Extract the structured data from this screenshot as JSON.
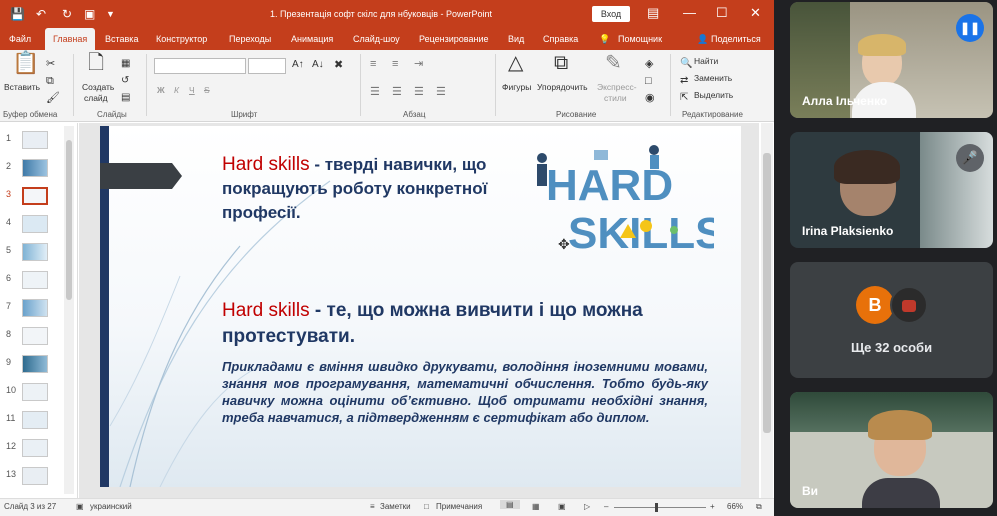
{
  "window": {
    "title": "1. Презентація софт скілс для нбуковців - PowerPoint",
    "signin": "Вход"
  },
  "tabs": [
    "Файл",
    "Главная",
    "Вставка",
    "Конструктор",
    "Переходы",
    "Анимация",
    "Слайд-шоу",
    "Рецензирование",
    "Вид",
    "Справка",
    "Помощник",
    "Поделиться"
  ],
  "ribbon": {
    "paste": "Вставить",
    "create_slide_1": "Создать",
    "create_slide_2": "слайд",
    "font_bold": "Ж",
    "font_italic": "К",
    "font_underline": "Ч",
    "font_strike": "S",
    "shapes": "Фигуры",
    "arrange": "Упорядочить",
    "quick_styles_1": "Экспресс-",
    "quick_styles_2": "стили",
    "find": "Найти",
    "replace": "Заменить",
    "select": "Выделить",
    "groups": [
      "Буфер обмена",
      "Слайды",
      "Шрифт",
      "Абзац",
      "Рисование",
      "Редактирование"
    ]
  },
  "thumbnails": [
    "1",
    "2",
    "3",
    "4",
    "5",
    "6",
    "7",
    "8",
    "9",
    "10",
    "11",
    "12",
    "13"
  ],
  "selected_slide": "3",
  "slide": {
    "block1_term": "Hard skills",
    "block1_text": " - тверді навички, що покращують роботу конкретної професії.",
    "logo_line1": "HARD",
    "logo_line2": "SKILLS",
    "block2_term": "Hard skills",
    "block2_text": " - те, що можна вивчити і що можна протестувати.",
    "body": "Прикладами є вміння швидко друкувати, володіння іноземними мовами, знання мов програмування, математичні обчислення. Тобто будь-яку навичку можна оцінити об’єктивно. Щоб отримати необхідні знання, треба навчатися, а підтвердженням є сертифікат або диплом."
  },
  "statusbar": {
    "slide_info": "Слайд 3 из 27",
    "language": "украинский",
    "notes": "Заметки",
    "comments": "Примечания",
    "zoom": "66%"
  },
  "meet": {
    "participants": [
      {
        "name": "Алла Ільченко"
      },
      {
        "name": "Irina Plaksienko"
      },
      {
        "name": "Ви"
      }
    ],
    "others_label": "Ще 32 особи",
    "others_avatar_letter": "В"
  },
  "colors": {
    "ppt_accent": "#c43e1c",
    "slide_navy": "#203864",
    "slide_red": "#c00000",
    "meet_tile": "#3c4043",
    "avatar_orange": "#e8710a"
  }
}
